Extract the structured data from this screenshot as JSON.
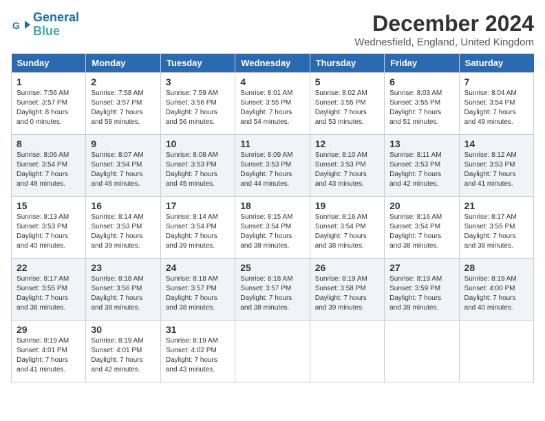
{
  "header": {
    "logo_line1": "General",
    "logo_line2": "Blue",
    "month": "December 2024",
    "location": "Wednesfield, England, United Kingdom"
  },
  "columns": [
    "Sunday",
    "Monday",
    "Tuesday",
    "Wednesday",
    "Thursday",
    "Friday",
    "Saturday"
  ],
  "weeks": [
    [
      {
        "day": 1,
        "sunrise": "7:56 AM",
        "sunset": "3:57 PM",
        "daylight": "8 hours and 0 minutes."
      },
      {
        "day": 2,
        "sunrise": "7:58 AM",
        "sunset": "3:57 PM",
        "daylight": "7 hours and 58 minutes."
      },
      {
        "day": 3,
        "sunrise": "7:59 AM",
        "sunset": "3:56 PM",
        "daylight": "7 hours and 56 minutes."
      },
      {
        "day": 4,
        "sunrise": "8:01 AM",
        "sunset": "3:55 PM",
        "daylight": "7 hours and 54 minutes."
      },
      {
        "day": 5,
        "sunrise": "8:02 AM",
        "sunset": "3:55 PM",
        "daylight": "7 hours and 53 minutes."
      },
      {
        "day": 6,
        "sunrise": "8:03 AM",
        "sunset": "3:55 PM",
        "daylight": "7 hours and 51 minutes."
      },
      {
        "day": 7,
        "sunrise": "8:04 AM",
        "sunset": "3:54 PM",
        "daylight": "7 hours and 49 minutes."
      }
    ],
    [
      {
        "day": 8,
        "sunrise": "8:06 AM",
        "sunset": "3:54 PM",
        "daylight": "7 hours and 48 minutes."
      },
      {
        "day": 9,
        "sunrise": "8:07 AM",
        "sunset": "3:54 PM",
        "daylight": "7 hours and 46 minutes."
      },
      {
        "day": 10,
        "sunrise": "8:08 AM",
        "sunset": "3:53 PM",
        "daylight": "7 hours and 45 minutes."
      },
      {
        "day": 11,
        "sunrise": "8:09 AM",
        "sunset": "3:53 PM",
        "daylight": "7 hours and 44 minutes."
      },
      {
        "day": 12,
        "sunrise": "8:10 AM",
        "sunset": "3:53 PM",
        "daylight": "7 hours and 43 minutes."
      },
      {
        "day": 13,
        "sunrise": "8:11 AM",
        "sunset": "3:53 PM",
        "daylight": "7 hours and 42 minutes."
      },
      {
        "day": 14,
        "sunrise": "8:12 AM",
        "sunset": "3:53 PM",
        "daylight": "7 hours and 41 minutes."
      }
    ],
    [
      {
        "day": 15,
        "sunrise": "8:13 AM",
        "sunset": "3:53 PM",
        "daylight": "7 hours and 40 minutes."
      },
      {
        "day": 16,
        "sunrise": "8:14 AM",
        "sunset": "3:53 PM",
        "daylight": "7 hours and 39 minutes."
      },
      {
        "day": 17,
        "sunrise": "8:14 AM",
        "sunset": "3:54 PM",
        "daylight": "7 hours and 39 minutes."
      },
      {
        "day": 18,
        "sunrise": "8:15 AM",
        "sunset": "3:54 PM",
        "daylight": "7 hours and 38 minutes."
      },
      {
        "day": 19,
        "sunrise": "8:16 AM",
        "sunset": "3:54 PM",
        "daylight": "7 hours and 38 minutes."
      },
      {
        "day": 20,
        "sunrise": "8:16 AM",
        "sunset": "3:54 PM",
        "daylight": "7 hours and 38 minutes."
      },
      {
        "day": 21,
        "sunrise": "8:17 AM",
        "sunset": "3:55 PM",
        "daylight": "7 hours and 38 minutes."
      }
    ],
    [
      {
        "day": 22,
        "sunrise": "8:17 AM",
        "sunset": "3:55 PM",
        "daylight": "7 hours and 38 minutes."
      },
      {
        "day": 23,
        "sunrise": "8:18 AM",
        "sunset": "3:56 PM",
        "daylight": "7 hours and 38 minutes."
      },
      {
        "day": 24,
        "sunrise": "8:18 AM",
        "sunset": "3:57 PM",
        "daylight": "7 hours and 38 minutes."
      },
      {
        "day": 25,
        "sunrise": "8:18 AM",
        "sunset": "3:57 PM",
        "daylight": "7 hours and 38 minutes."
      },
      {
        "day": 26,
        "sunrise": "8:19 AM",
        "sunset": "3:58 PM",
        "daylight": "7 hours and 39 minutes."
      },
      {
        "day": 27,
        "sunrise": "8:19 AM",
        "sunset": "3:59 PM",
        "daylight": "7 hours and 39 minutes."
      },
      {
        "day": 28,
        "sunrise": "8:19 AM",
        "sunset": "4:00 PM",
        "daylight": "7 hours and 40 minutes."
      }
    ],
    [
      {
        "day": 29,
        "sunrise": "8:19 AM",
        "sunset": "4:01 PM",
        "daylight": "7 hours and 41 minutes."
      },
      {
        "day": 30,
        "sunrise": "8:19 AM",
        "sunset": "4:01 PM",
        "daylight": "7 hours and 42 minutes."
      },
      {
        "day": 31,
        "sunrise": "8:19 AM",
        "sunset": "4:02 PM",
        "daylight": "7 hours and 43 minutes."
      },
      null,
      null,
      null,
      null
    ]
  ]
}
